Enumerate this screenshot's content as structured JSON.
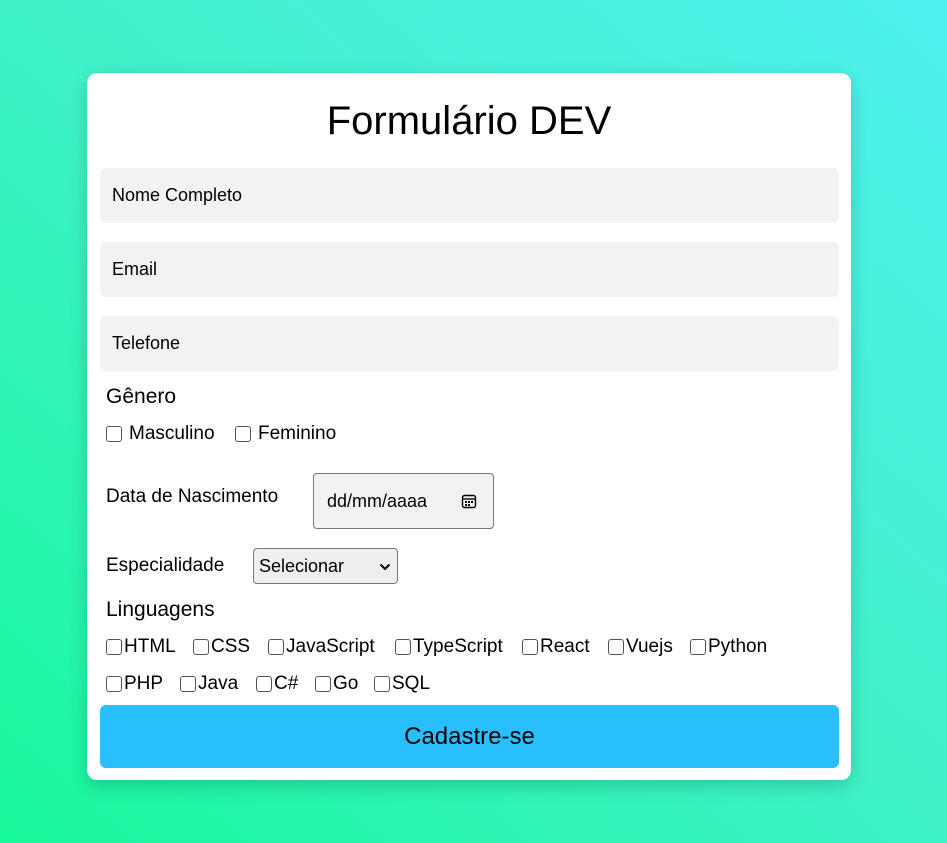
{
  "form": {
    "title": "Formulário DEV",
    "fields": {
      "name_placeholder": "Nome Completo",
      "email_placeholder": "Email",
      "phone_placeholder": "Telefone"
    },
    "gender": {
      "label": "Gênero",
      "options": [
        "Masculino",
        "Feminino"
      ]
    },
    "birthdate": {
      "label": "Data de Nascimento",
      "placeholder": "dd/mm/aaaa"
    },
    "specialty": {
      "label": "Especialidade",
      "selected": "Selecionar"
    },
    "languages": {
      "label": "Linguagens",
      "options": [
        "HTML",
        "CSS",
        "JavaScript",
        "TypeScript",
        "React",
        "Vuejs",
        "Python",
        "PHP",
        "Java",
        "C#",
        "Go",
        "SQL"
      ]
    },
    "submit_label": "Cadastre-se"
  }
}
